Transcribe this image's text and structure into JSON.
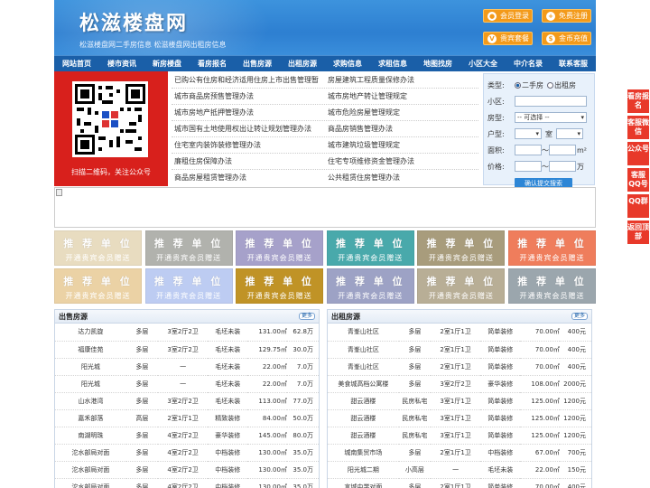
{
  "header": {
    "logo": "松滋楼盘网",
    "tagline": "松滋楼盘网二手房信息   松滋楼盘网出租房信息",
    "buttons": [
      "会员登录",
      "免费注册",
      "贵宾套餐",
      "金币充值"
    ]
  },
  "nav": [
    "网站首页",
    "楼市资讯",
    "新房楼盘",
    "看房报名",
    "出售房源",
    "出租房源",
    "求购信息",
    "求租信息",
    "地图找房",
    "小区大全",
    "中介名录",
    "联系客服"
  ],
  "qr_caption": "扫描二维码，关注公众号",
  "policy_links": [
    [
      "已购公有住房和经济适用住房上市出售管理暂",
      "房屋建筑工程质量保修办法"
    ],
    [
      "城市商品房预售管理办法",
      "城市房地产转让管理规定"
    ],
    [
      "城市房地产抵押管理办法",
      "城市危险房屋管理规定"
    ],
    [
      "城市国有土地使用权出让转让规划管理办法",
      "商品房销售管理办法"
    ],
    [
      "住宅室内装饰装修管理办法",
      "城市建筑垃圾管理规定"
    ],
    [
      "廉租住房保障办法",
      "住宅专项维修资金管理办法"
    ],
    [
      "商品房屋租赁管理办法",
      "公共租赁住房管理办法"
    ]
  ],
  "search": {
    "type_label": "类型:",
    "type_options": [
      "二手房",
      "出租房"
    ],
    "community_label": "小区:",
    "house_type_label": "房型:",
    "house_type_value": "-- 可选择 --",
    "layout_label": "户型:",
    "room_unit": "室",
    "area_label": "面积:",
    "area_unit": "m²",
    "price_label": "价格:",
    "price_unit": "万",
    "range_sep": "〜",
    "submit": "确认提交搜索"
  },
  "ads": {
    "line1": "推 荐 单 位",
    "line2": "开通贵宾会员赠送",
    "colors": [
      "#e8dcc0",
      "#b1b2ad",
      "#a6a1ca",
      "#49a9ab",
      "#a89c7c",
      "#ef7d5c",
      "#ebd2a5",
      "#bdccf2",
      "#c09326",
      "#9da2c5",
      "#b8ae96",
      "#9ba6ad"
    ]
  },
  "sale": {
    "title": "出售房源",
    "more": "更多",
    "rows": [
      [
        "达力凯旋",
        "多层",
        "3室2厅2卫",
        "毛坯未装",
        "131.00㎡",
        "62.8万"
      ],
      [
        "福康佳苑",
        "多层",
        "3室2厅2卫",
        "毛坯未装",
        "129.75㎡",
        "30.0万"
      ],
      [
        "阳光城",
        "多层",
        "一",
        "毛坯未装",
        "22.00㎡",
        "7.0万"
      ],
      [
        "阳光城",
        "多层",
        "一",
        "毛坯未装",
        "22.00㎡",
        "7.0万"
      ],
      [
        "山水港湾",
        "多层",
        "3室2厅2卫",
        "毛坯未装",
        "113.00㎡",
        "77.0万"
      ],
      [
        "嘉禾部落",
        "高层",
        "2室1厅1卫",
        "精致装修",
        "84.00㎡",
        "50.0万"
      ],
      [
        "南湖明珠",
        "多层",
        "4室2厅2卫",
        "豪华装修",
        "145.00㎡",
        "80.0万"
      ],
      [
        "沱水部局对面",
        "多层",
        "4室2厅2卫",
        "中档装修",
        "130.00㎡",
        "35.0万"
      ],
      [
        "沱水部局对面",
        "多层",
        "4室2厅2卫",
        "中档装修",
        "130.00㎡",
        "35.0万"
      ],
      [
        "沱水部局对面",
        "多层",
        "4室2厅2卫",
        "中档装修",
        "130.00㎡",
        "35.0万"
      ]
    ]
  },
  "rent": {
    "title": "出租房源",
    "more": "更多",
    "rows": [
      [
        "青峯山社区",
        "多层",
        "2室1厅1卫",
        "简单装修",
        "70.00㎡",
        "400元"
      ],
      [
        "青峯山社区",
        "多层",
        "2室1厅1卫",
        "简单装修",
        "70.00㎡",
        "400元"
      ],
      [
        "青峯山社区",
        "多层",
        "2室1厅1卫",
        "简单装修",
        "70.00㎡",
        "400元"
      ],
      [
        "美食城高档公寓楼",
        "多层",
        "3室2厅2卫",
        "豪华装修",
        "108.00㎡",
        "2000元"
      ],
      [
        "甜云酒楼",
        "民房私宅",
        "3室1厅1卫",
        "简单装修",
        "125.00㎡",
        "1200元"
      ],
      [
        "甜云酒楼",
        "民房私宅",
        "3室1厅1卫",
        "简单装修",
        "125.00㎡",
        "1200元"
      ],
      [
        "甜云酒楼",
        "民房私宅",
        "3室1厅1卫",
        "简单装修",
        "125.00㎡",
        "1200元"
      ],
      [
        "城南集贸市场",
        "多层",
        "2室1厅1卫",
        "中档装修",
        "67.00㎡",
        "700元"
      ],
      [
        "阳光城二期",
        "小高层",
        "一",
        "毛坯未装",
        "22.00㎡",
        "150元"
      ],
      [
        "言城中学对面",
        "多层",
        "2室1厅1卫",
        "简单装修",
        "70.00㎡",
        "400元"
      ]
    ]
  },
  "sidebar": [
    "看房报名",
    "客服微信",
    "公众号",
    "客服QQ号",
    "QQ群",
    "返回顶部"
  ]
}
